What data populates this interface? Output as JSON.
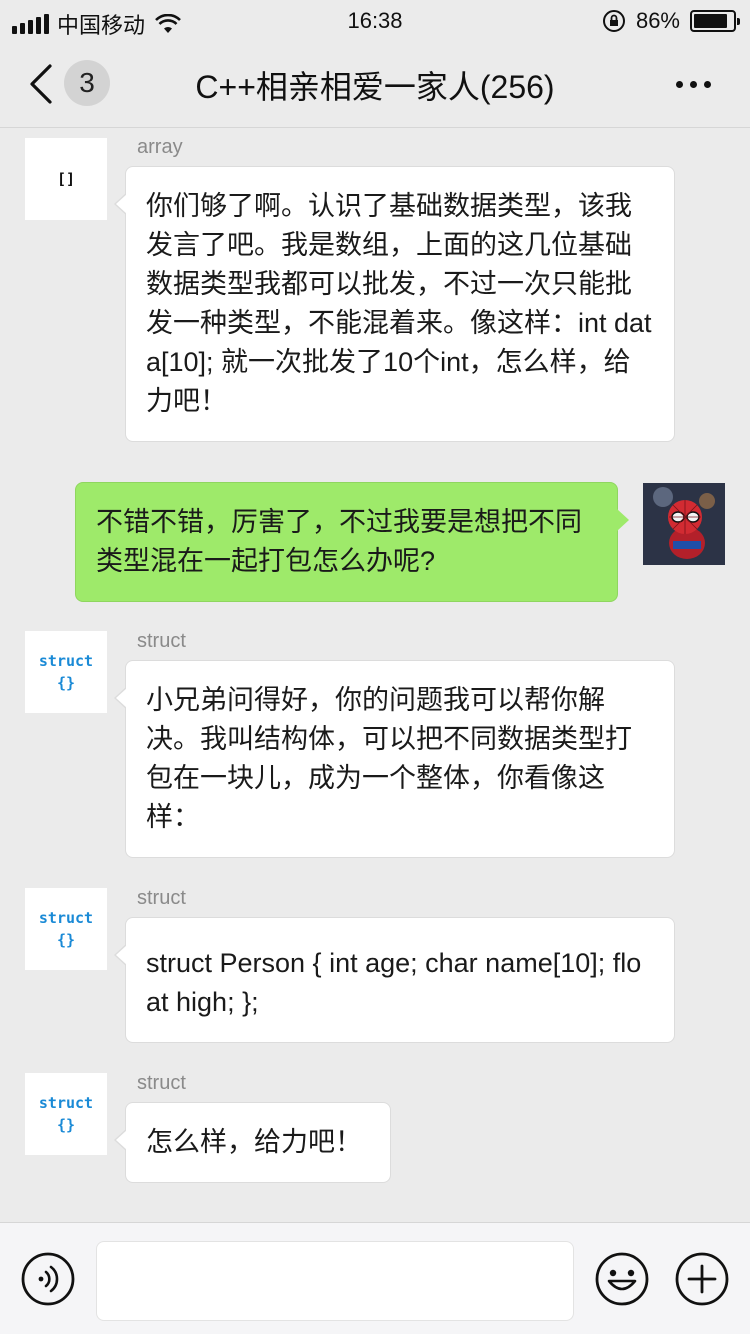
{
  "status_bar": {
    "carrier": "中国移动",
    "time": "16:38",
    "battery": "86%",
    "battery_level": 0.86
  },
  "nav": {
    "unread_count": "3",
    "title": "C++相亲相爱一家人(256)"
  },
  "messages": [
    {
      "side": "left",
      "sender": "array",
      "avatar_text": "[]",
      "text": "你们够了啊。认识了基础数据类型，该我发言了吧。我是数组，上面的这几位基础数据类型我都可以批发，不过一次只能批发一种类型，不能混着来。像这样：int data[10]; 就一次批发了10个int，怎么样，给力吧！"
    },
    {
      "side": "right",
      "avatar_icon": "spiderman-avatar",
      "text": "不错不错，厉害了，不过我要是想把不同类型混在一起打包怎么办呢?"
    },
    {
      "side": "left",
      "sender": "struct",
      "avatar_text": "struct {}",
      "text": "小兄弟问得好，你的问题我可以帮你解决。我叫结构体，可以把不同数据类型打包在一块儿，成为一个整体，你看像这样："
    },
    {
      "side": "left",
      "sender": "struct",
      "avatar_text": "struct {}",
      "text": "struct Person { int age; char name[10]; float high; };"
    },
    {
      "side": "left",
      "sender": "struct",
      "avatar_text": "struct {}",
      "text": "怎么样，给力吧！"
    }
  ],
  "input": {
    "value": "",
    "placeholder": ""
  },
  "icons": {
    "back": "chevron-left-icon",
    "more": "more-icon",
    "voice": "voice-icon",
    "emoji": "emoji-icon",
    "plus": "plus-icon"
  },
  "colors": {
    "my_bubble": "#9eea6a",
    "other_bubble": "#ffffff",
    "struct_avatar_text": "#1a8ad6",
    "background": "#ebebeb"
  }
}
